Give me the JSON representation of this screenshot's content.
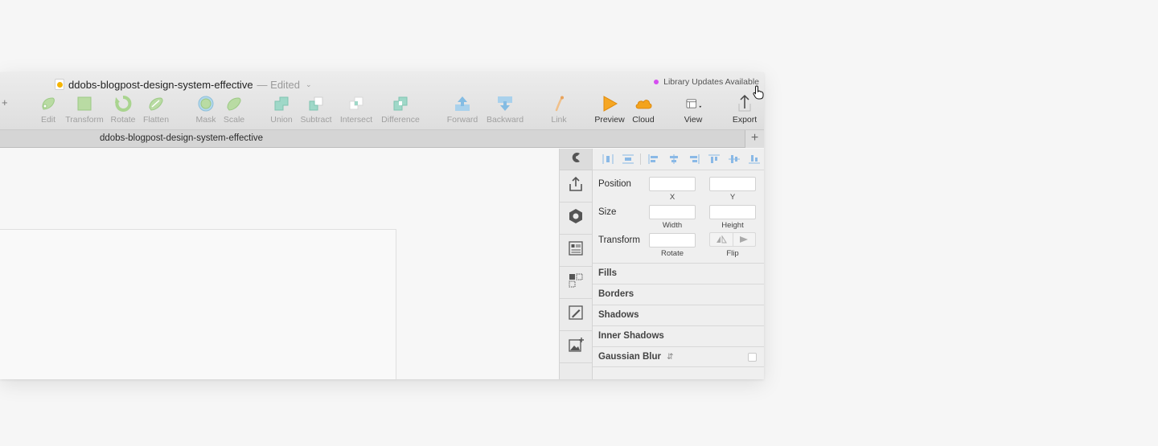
{
  "window": {
    "doc_title": "ddobs-blogpost-design-system-effective",
    "edited_label": "— Edited",
    "library_updates": "Library Updates Available",
    "colors": {
      "library_dot": "#d54ef0",
      "preview_icon": "#f5a623",
      "cloud_icon": "#f09a1a"
    }
  },
  "toolbar": {
    "add_label": "+",
    "tools": [
      {
        "label": "Edit",
        "icon": "edit-icon"
      },
      {
        "label": "Transform",
        "icon": "transform-icon"
      },
      {
        "label": "Rotate",
        "icon": "rotate-icon"
      },
      {
        "label": "Flatten",
        "icon": "flatten-icon"
      },
      {
        "label": "Mask",
        "icon": "mask-icon"
      },
      {
        "label": "Scale",
        "icon": "scale-icon"
      },
      {
        "label": "Union",
        "icon": "union-icon"
      },
      {
        "label": "Subtract",
        "icon": "subtract-icon"
      },
      {
        "label": "Intersect",
        "icon": "intersect-icon"
      },
      {
        "label": "Difference",
        "icon": "difference-icon"
      },
      {
        "label": "Forward",
        "icon": "forward-icon"
      },
      {
        "label": "Backward",
        "icon": "backward-icon"
      },
      {
        "label": "Link",
        "icon": "link-icon"
      },
      {
        "label": "Preview",
        "icon": "preview-icon"
      },
      {
        "label": "Cloud",
        "icon": "cloud-icon"
      },
      {
        "label": "View",
        "icon": "view-icon"
      },
      {
        "label": "Export",
        "icon": "export-icon"
      }
    ]
  },
  "tabbar": {
    "title": "ddobs-blogpost-design-system-effective",
    "add_label": "+"
  },
  "inspector": {
    "position_label": "Position",
    "size_label": "Size",
    "transform_label": "Transform",
    "x_caption": "X",
    "y_caption": "Y",
    "width_caption": "Width",
    "height_caption": "Height",
    "rotate_caption": "Rotate",
    "flip_caption": "Flip",
    "sections": [
      "Fills",
      "Borders",
      "Shadows",
      "Inner Shadows",
      "Gaussian Blur"
    ]
  }
}
